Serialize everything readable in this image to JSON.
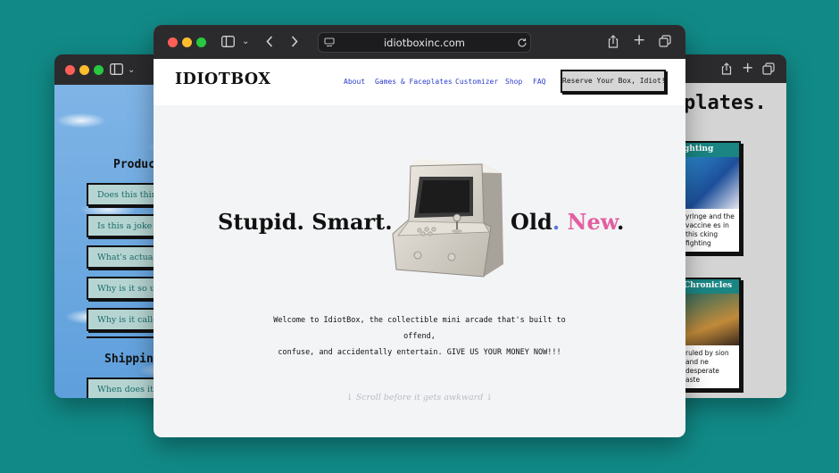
{
  "left_window": {
    "product_heading": "Produc",
    "shipping_heading": "Shippin",
    "faq_items": [
      "Does this thing",
      "Is this a joke o",
      "What's actually",
      "Why is it so ugl",
      "Why is it called"
    ],
    "shipping_items": [
      "When does it sh"
    ]
  },
  "right_window": {
    "heading": "plates.",
    "cards": [
      {
        "title": "ghting",
        "description": "yringe and the vaccine es in this cking fighting"
      },
      {
        "title": "Chronicles",
        "description": "ruled by sion and ne desperate aste"
      }
    ]
  },
  "main_window": {
    "url": "idiotboxinc.com",
    "logo": "IDIOTBOX",
    "nav": [
      "About",
      "Games & Faceplates",
      "Customizer",
      "Shop",
      "FAQ"
    ],
    "cta": "Reserve Your Box, Idiot!",
    "hero": {
      "left": "Stupid. Smart.",
      "word_old": "Old",
      "dot_old": ".",
      "word_new": "New",
      "dot_new": "."
    },
    "tagline_line1": "Welcome to IdiotBox, the collectible mini arcade that's built to offend,",
    "tagline_line2": "confuse, and accidentally entertain. GIVE US YOUR MONEY NOW!!!",
    "scroll_hint": "↓ Scroll before it gets awkward ↓"
  },
  "colors": {
    "background": "#118a87",
    "nav_link": "#2a3cc8",
    "card_header": "#1a8583",
    "old_color": "#e0a82a",
    "new_color": "#e35fa0"
  },
  "icons": [
    "sidebar-icon",
    "chevron-down-icon",
    "back-icon",
    "forward-icon",
    "site-icon",
    "reload-icon",
    "share-icon",
    "new-tab-icon",
    "tabs-icon",
    "arcade-cabinet-image"
  ]
}
